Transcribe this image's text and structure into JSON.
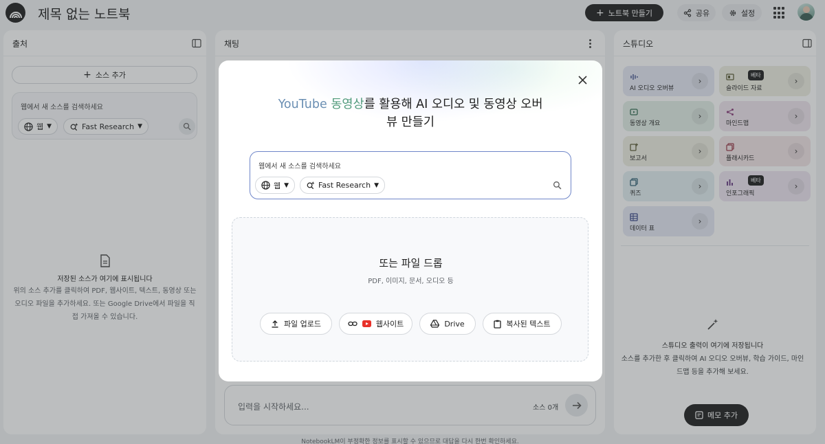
{
  "topbar": {
    "title": "제목 없는 노트북",
    "new_notebook": "노트북 만들기",
    "share": "공유",
    "settings": "설정"
  },
  "sources": {
    "title": "출처",
    "add_source": "소스 추가",
    "search_placeholder": "웹에서 새 소스를 검색하세요",
    "web_chip": "웹",
    "research_chip": "Fast Research",
    "empty_title": "저장된 소스가 여기에 표시됩니다",
    "empty_desc": "위의 소스 추가를 클릭하여 PDF, 웹사이트, 텍스트, 동영상 또는 오디오 파일을 추가하세요. 또는 Google Drive에서 파일을 직접 가져올 수 있습니다."
  },
  "chat": {
    "title": "채팅",
    "input_placeholder": "입력을 시작하세요...",
    "source_count": "소스 0개"
  },
  "studio": {
    "title": "스튜디오",
    "cards": [
      {
        "label": "AI 오디오 오버뷰",
        "icon": "audio-wave-icon",
        "beta": "",
        "color": "#e6e9f5"
      },
      {
        "label": "슬라이드 자료",
        "icon": "slides-icon",
        "beta": "베타",
        "color": "#efefe3"
      },
      {
        "label": "동영상 개요",
        "icon": "video-icon",
        "beta": "",
        "color": "#e3efe7"
      },
      {
        "label": "마인드맵",
        "icon": "mindmap-icon",
        "beta": "",
        "color": "#f0e6ef"
      },
      {
        "label": "보고서",
        "icon": "report-icon",
        "beta": "",
        "color": "#efeee2"
      },
      {
        "label": "플래시카드",
        "icon": "flashcard-icon",
        "beta": "",
        "color": "#f3e5e7"
      },
      {
        "label": "퀴즈",
        "icon": "quiz-icon",
        "beta": "",
        "color": "#e3eff2"
      },
      {
        "label": "인포그래픽",
        "icon": "infographic-icon",
        "beta": "베타",
        "color": "#eee6f1"
      },
      {
        "label": "데이터 표",
        "icon": "table-icon",
        "beta": "",
        "color": "#e6e9f5"
      }
    ],
    "empty_title": "스튜디오 출력이 여기에 저장됩니다",
    "empty_desc": "소스를 추가한 후 클릭하여 AI 오디오 오버뷰, 학습 가이드, 마인드맵 등을 추가해 보세요.",
    "memo_button": "메모 추가"
  },
  "footer": "NotebookLM이 부정확한 정보를 표시할 수 있으므로 대답을 다시 한번 확인하세요.",
  "modal": {
    "title_youtube": "YouTube",
    "title_video": "동영상",
    "title_rest": "를 활용해 AI 오디오 및 동영상 오버뷰 만들기",
    "search_placeholder": "웹에서 새 소스를 검색하세요",
    "web_chip": "웹",
    "research_chip": "Fast Research",
    "drop_title": "또는 파일 드롭",
    "drop_sub": "PDF, 이미지, 문서, 오디오 등",
    "buttons": {
      "upload": "파일 업로드",
      "website": "웹사이트",
      "drive": "Drive",
      "copied_text": "복사된 텍스트"
    }
  }
}
